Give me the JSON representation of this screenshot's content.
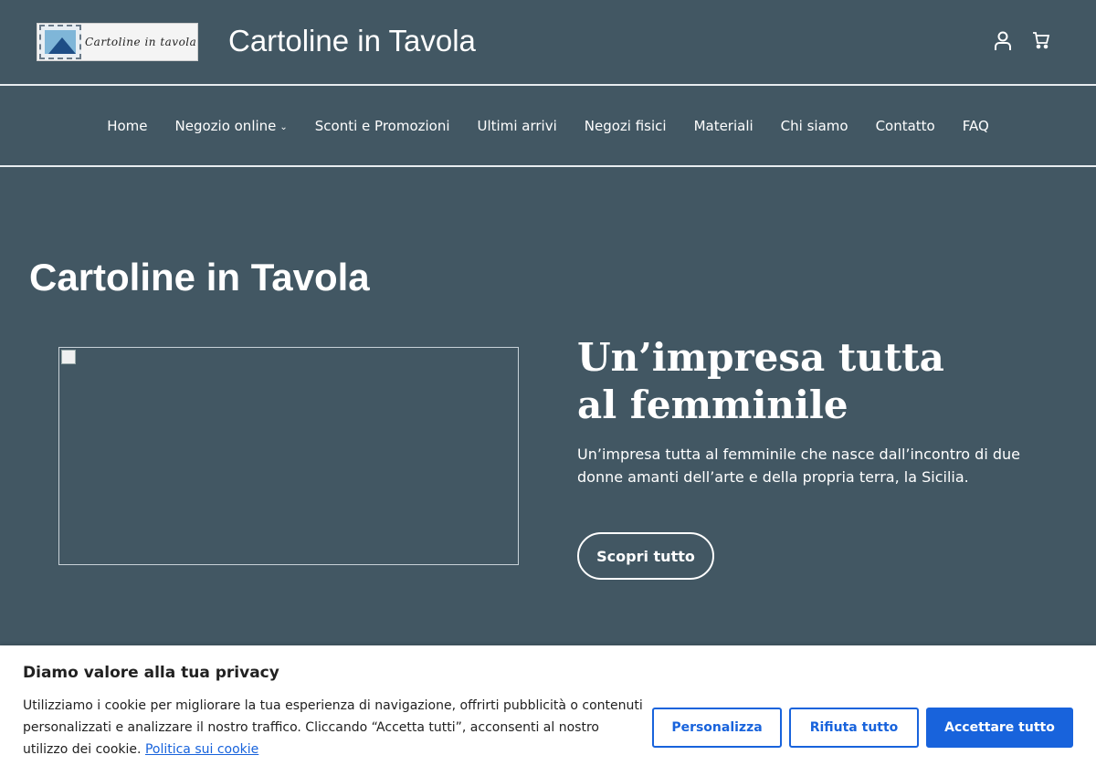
{
  "header": {
    "logo_text": "Cartoline in tavola",
    "site_title": "Cartoline in Tavola",
    "icons": [
      "account-icon",
      "cart-icon"
    ]
  },
  "nav": {
    "items": [
      {
        "label": "Home"
      },
      {
        "label": "Negozio online",
        "has_dropdown": true
      },
      {
        "label": "Sconti e Promozioni"
      },
      {
        "label": "Ultimi arrivi"
      },
      {
        "label": "Negozi fisici"
      },
      {
        "label": "Materiali"
      },
      {
        "label": "Chi siamo"
      },
      {
        "label": "Contatto"
      },
      {
        "label": "FAQ"
      }
    ],
    "dropdown_glyph": "⌄"
  },
  "hero": {
    "page_heading": "Cartoline in Tavola",
    "title_line1": "Un’impresa tutta",
    "title_line2": "al femminile",
    "text": "Un’impresa tutta al femminile che nasce dall’incontro di due donne amanti dell’arte e della propria terra, la Sicilia.",
    "button_label": "Scopri tutto"
  },
  "cookie": {
    "title": "Diamo valore alla tua privacy",
    "text": "Utilizziamo i cookie per migliorare la tua esperienza di navigazione, offrirti pubblicità o contenuti personalizzati e analizzare il nostro traffico. Cliccando “Accetta tutti”, acconsenti al nostro utilizzo dei cookie.",
    "link_label": "Politica sui cookie",
    "customize_label": "Personalizza",
    "reject_label": "Rifiuta tutto",
    "accept_label": "Accettare tutto"
  },
  "colors": {
    "background": "#425763",
    "accent": "#1863dc",
    "text": "#ffffff"
  }
}
